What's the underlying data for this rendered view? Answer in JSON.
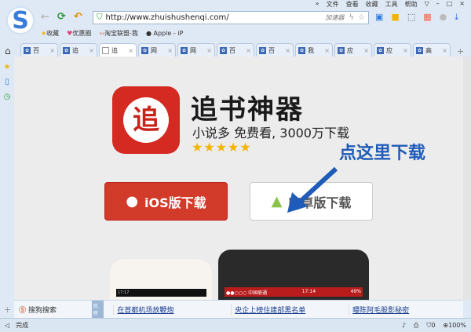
{
  "menu": {
    "more": "»",
    "items": [
      "文件",
      "查看",
      "收藏",
      "工具",
      "帮助"
    ],
    "window": [
      "▽",
      "–",
      "□",
      "×"
    ]
  },
  "nav": {
    "back": "←",
    "refresh": "⟳",
    "undo": "↶"
  },
  "address": {
    "url": "http://www.zhuishushenqi.com/",
    "accelerate": "加速器"
  },
  "bookmarks": [
    "收藏",
    "优惠圈",
    "淘宝联盟-我",
    "Apple - iP"
  ],
  "tabs": [
    "百",
    "追",
    "追",
    "网",
    "网",
    "百",
    "百",
    "我",
    "应",
    "应",
    "高"
  ],
  "page": {
    "app_glyph": "追",
    "title": "追书神器",
    "subtitle": "小说多 免费看, 3000万下载",
    "stars": "★★★★★",
    "rating": 5,
    "hint": "点这里下载",
    "ios_label": "iOS版下载",
    "android_label": "安卓版下载",
    "phone1_status": "17:17",
    "phone2_carrier": "●●○○○ 中国联通",
    "phone2_time": "17:14",
    "phone2_battery": "49%"
  },
  "news": {
    "source": "搜狗搜索",
    "hot": "热榜",
    "items": [
      "在首都机场放鞭炮",
      "央企上榜住建部黑名单",
      "曝陈阿毛股影秘密"
    ]
  },
  "status": {
    "text": "完成",
    "shield": "0",
    "zoom": "100%"
  },
  "colors": {
    "accent": "#1f5bb8",
    "ios": "#d23a2a"
  }
}
